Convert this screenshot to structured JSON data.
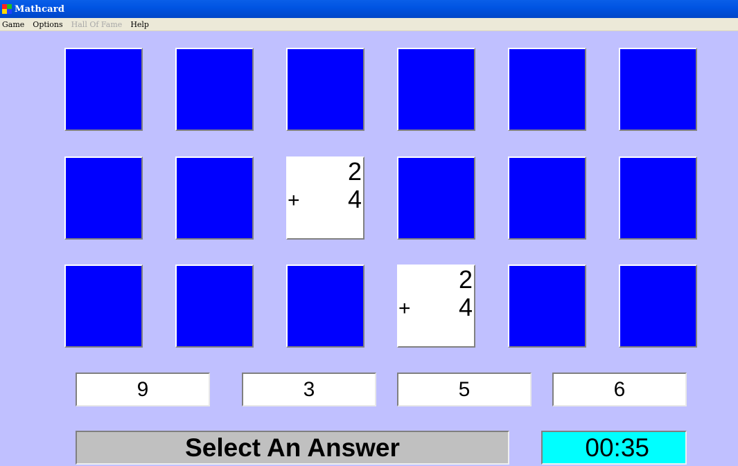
{
  "window": {
    "title": "Mathcard",
    "icon": "app-icon",
    "colors": {
      "titlebar": "#0054e3",
      "background": "#c0c0ff"
    }
  },
  "menu": {
    "items": [
      {
        "label": "Game",
        "enabled": true
      },
      {
        "label": "Options",
        "enabled": true
      },
      {
        "label": "Hall Of Fame",
        "enabled": false
      },
      {
        "label": "Help",
        "enabled": true
      }
    ]
  },
  "board": {
    "rows": 3,
    "cols": 6,
    "card_back_color": "#0000ff",
    "face_color": "#ffffff",
    "revealed": [
      {
        "row": 2,
        "col": 3,
        "top": "2",
        "operator": "+",
        "bottom": "4"
      },
      {
        "row": 3,
        "col": 4,
        "top": "2",
        "operator": "+",
        "bottom": "4"
      }
    ]
  },
  "answers": [
    "9",
    "3",
    "5",
    "6"
  ],
  "status": {
    "message": "Select An Answer",
    "timer": "00:35",
    "timer_color": "#00ffff"
  }
}
